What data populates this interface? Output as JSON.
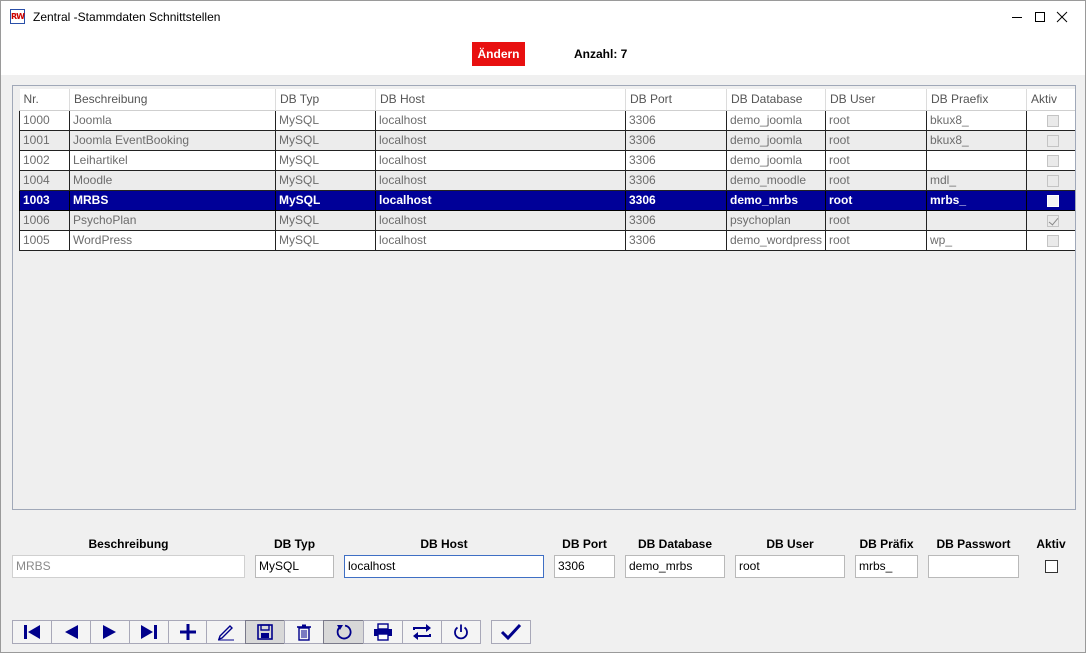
{
  "window": {
    "title": "Zentral -Stammdaten Schnittstellen",
    "icon_text": "RW"
  },
  "header": {
    "mode_label": "Ändern",
    "count_label": "Anzahl: 7"
  },
  "grid": {
    "columns": [
      "Nr.",
      "Beschreibung",
      "DB Typ",
      "DB Host",
      "DB Port",
      "DB Database",
      "DB User",
      "DB Praefix",
      "Aktiv"
    ],
    "rows": [
      {
        "nr": "1000",
        "beschreibung": "Joomla",
        "typ": "MySQL",
        "host": "localhost",
        "port": "3306",
        "database": "demo_joomla",
        "user": "root",
        "praefix": "bkux8_",
        "aktiv": false,
        "selected": false
      },
      {
        "nr": "1001",
        "beschreibung": "Joomla EventBooking",
        "typ": "MySQL",
        "host": "localhost",
        "port": "3306",
        "database": "demo_joomla",
        "user": "root",
        "praefix": "bkux8_",
        "aktiv": false,
        "selected": false
      },
      {
        "nr": "1002",
        "beschreibung": "Leihartikel",
        "typ": "MySQL",
        "host": "localhost",
        "port": "3306",
        "database": "demo_joomla",
        "user": "root",
        "praefix": "",
        "aktiv": false,
        "selected": false
      },
      {
        "nr": "1004",
        "beschreibung": "Moodle",
        "typ": "MySQL",
        "host": "localhost",
        "port": "3306",
        "database": "demo_moodle",
        "user": "root",
        "praefix": "mdl_",
        "aktiv": false,
        "selected": false
      },
      {
        "nr": "1003",
        "beschreibung": "MRBS",
        "typ": "MySQL",
        "host": "localhost",
        "port": "3306",
        "database": "demo_mrbs",
        "user": "root",
        "praefix": "mrbs_",
        "aktiv": false,
        "selected": true
      },
      {
        "nr": "1006",
        "beschreibung": "PsychoPlan",
        "typ": "MySQL",
        "host": "localhost",
        "port": "3306",
        "database": "psychoplan",
        "user": "root",
        "praefix": "",
        "aktiv": true,
        "selected": false
      },
      {
        "nr": "1005",
        "beschreibung": "WordPress",
        "typ": "MySQL",
        "host": "localhost",
        "port": "3306",
        "database": "demo_wordpress",
        "user": "root",
        "praefix": "wp_",
        "aktiv": false,
        "selected": false
      }
    ]
  },
  "form": {
    "beschreibung": {
      "label": "Beschreibung",
      "value": "MRBS"
    },
    "typ": {
      "label": "DB Typ",
      "value": "MySQL"
    },
    "host": {
      "label": "DB Host",
      "value": "localhost"
    },
    "port": {
      "label": "DB Port",
      "value": "3306"
    },
    "database": {
      "label": "DB Database",
      "value": "demo_mrbs"
    },
    "user": {
      "label": "DB User",
      "value": "root"
    },
    "praefix": {
      "label": "DB Präfix",
      "value": "mrbs_"
    },
    "passwort": {
      "label": "DB Passwort",
      "value": ""
    },
    "aktiv": {
      "label": "Aktiv",
      "checked": false
    }
  },
  "toolbar": {
    "icons": [
      "first-record-icon",
      "previous-record-icon",
      "next-record-icon",
      "last-record-icon",
      "add-icon",
      "edit-icon",
      "save-icon",
      "delete-icon",
      "undo-icon",
      "print-icon",
      "swap-icon",
      "power-icon",
      "confirm-icon"
    ]
  },
  "colors": {
    "selection": "#000098",
    "mode_badge": "#e81010",
    "icon_blue": "#00008b"
  }
}
